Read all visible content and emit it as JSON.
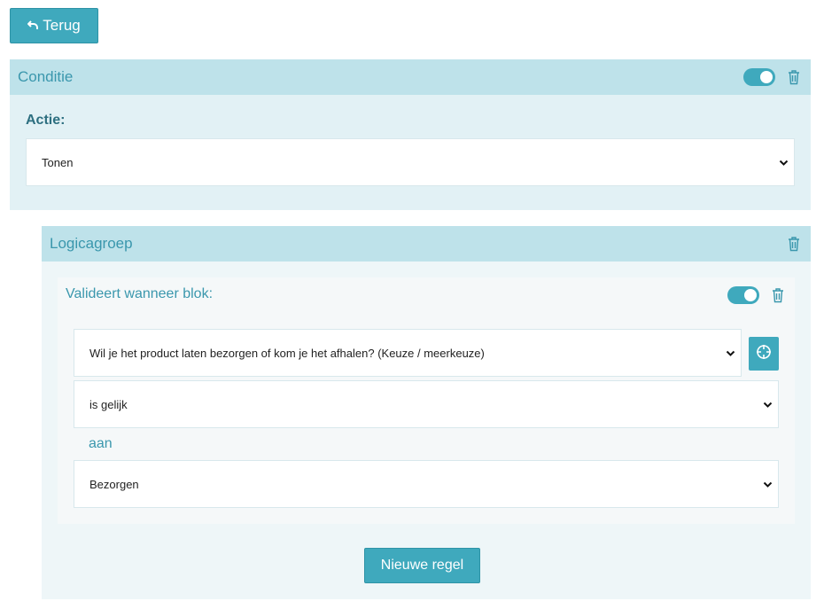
{
  "back_button": {
    "label": "Terug",
    "icon": "undo-icon"
  },
  "condition_panel": {
    "title": "Conditie",
    "action_label": "Actie:",
    "action_select": {
      "value": "Tonen"
    },
    "toggle": {
      "on": true
    },
    "colors": {
      "header": "#bee2ea",
      "body": "#e2f1f5",
      "accent": "#3fa9bd"
    }
  },
  "logic_group": {
    "title": "Logicagroep",
    "block": {
      "title": "Valideert wanneer blok:",
      "toggle": {
        "on": true
      },
      "question_select": {
        "value": "Wil je het product laten bezorgen of kom je het afhalen? (Keuze / meerkeuze)"
      },
      "operator_select": {
        "value": "is gelijk"
      },
      "connector_text": "aan",
      "value_select": {
        "value": "Bezorgen"
      }
    },
    "new_rule_button": "Nieuwe regel"
  }
}
